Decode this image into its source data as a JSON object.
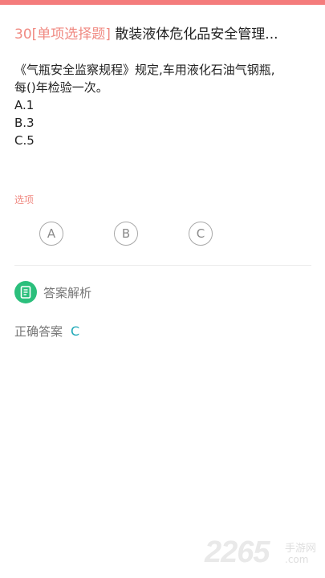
{
  "question": {
    "number": "30",
    "type": "[单项选择题]",
    "title": "散装液体危化品安全管理...",
    "stem_line1": "《气瓶安全监察规程》规定,车用液化石油气钢瓶,",
    "stem_line2": "每()年检验一次。",
    "choices": [
      "A.1",
      "B.3",
      "C.5"
    ]
  },
  "options": {
    "label": "选项",
    "buttons": [
      "A",
      "B",
      "C"
    ]
  },
  "analysis": {
    "label": "答案解析",
    "correct_label": "正确答案",
    "correct_value": "C"
  },
  "watermark": {
    "number": "2265",
    "chinese": "手游网",
    "domain": ".com"
  },
  "colors": {
    "accent": "#f47c7c",
    "green": "#2bbf7c",
    "answer": "#20a9b8"
  }
}
